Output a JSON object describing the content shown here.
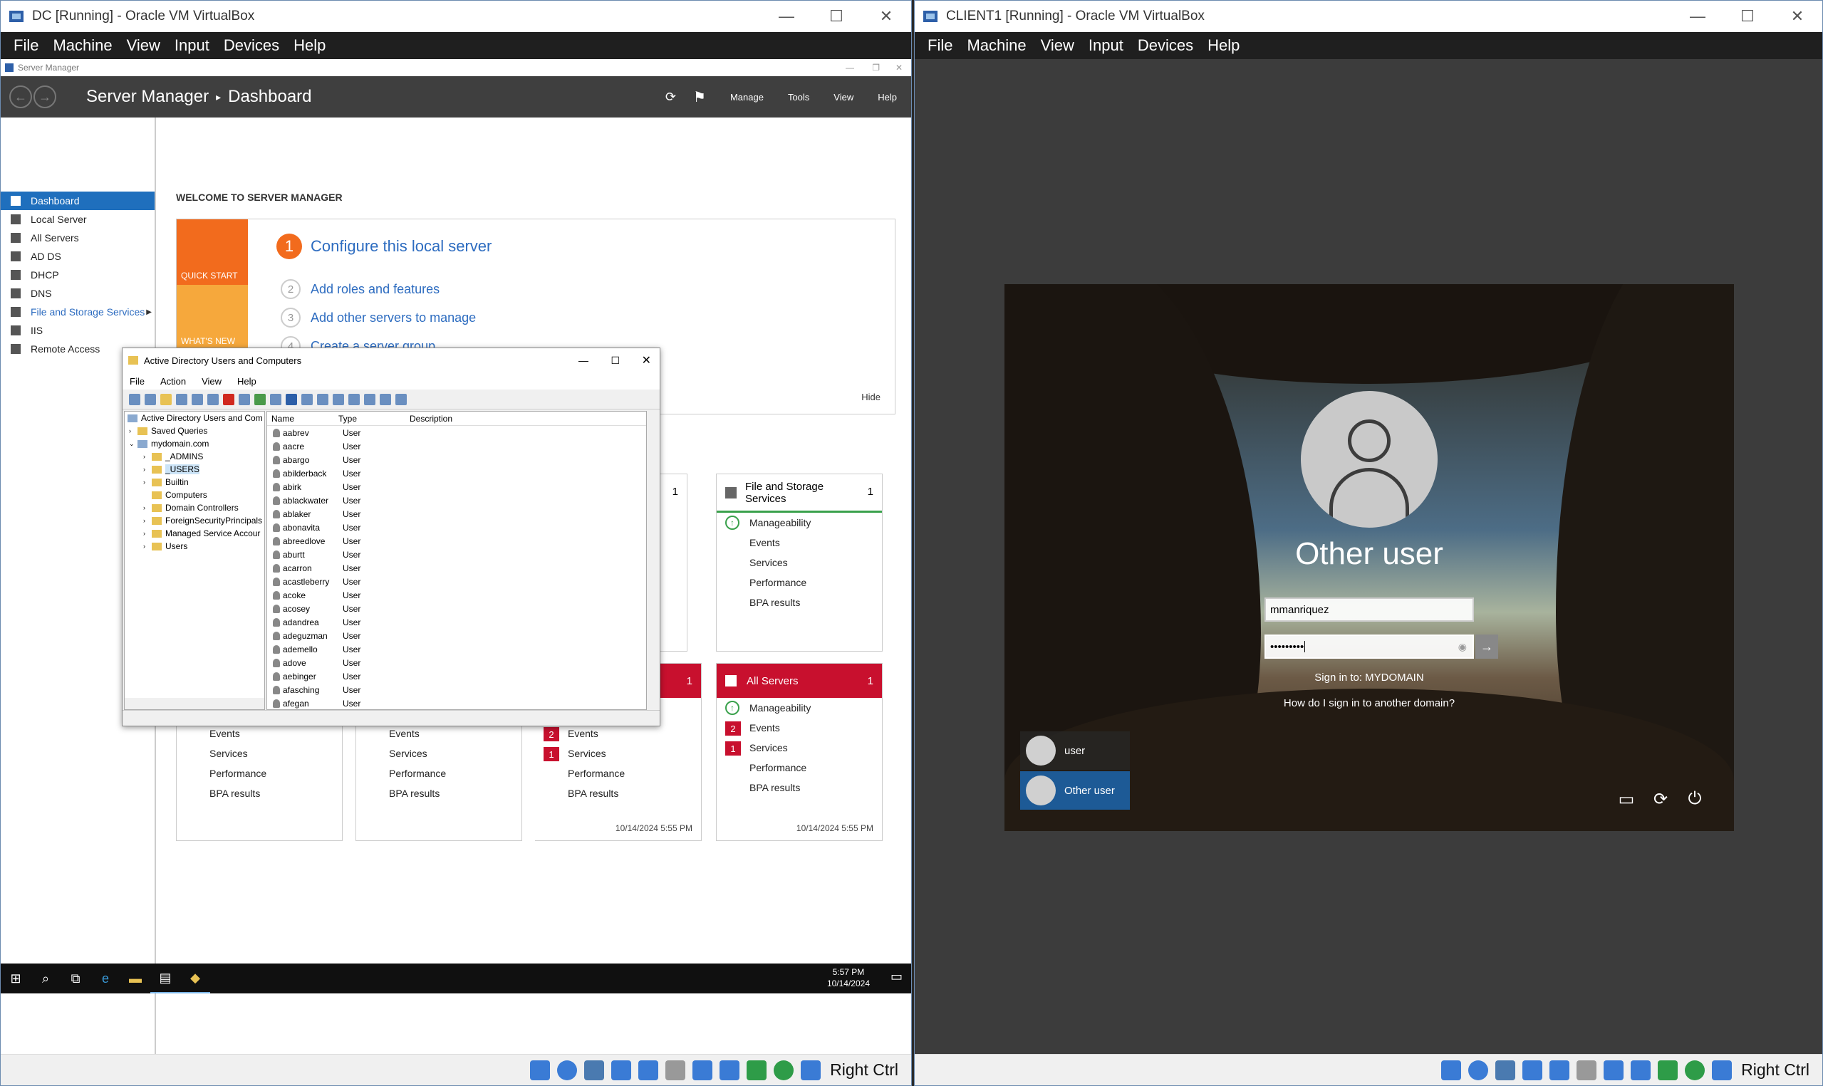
{
  "left_vm": {
    "title": "DC [Running] - Oracle VM VirtualBox",
    "menu": [
      "File",
      "Machine",
      "View",
      "Input",
      "Devices",
      "Help"
    ],
    "host_key": "Right Ctrl"
  },
  "server_manager": {
    "window_title": "Server Manager",
    "breadcrumb_app": "Server Manager",
    "breadcrumb_page": "Dashboard",
    "header_links": [
      "Manage",
      "Tools",
      "View",
      "Help"
    ],
    "sidebar": [
      {
        "label": "Dashboard",
        "selected": true
      },
      {
        "label": "Local Server"
      },
      {
        "label": "All Servers"
      },
      {
        "label": "AD DS"
      },
      {
        "label": "DHCP"
      },
      {
        "label": "DNS"
      },
      {
        "label": "File and Storage Services"
      },
      {
        "label": "IIS"
      },
      {
        "label": "Remote Access"
      }
    ],
    "welcome": "WELCOME TO SERVER MANAGER",
    "quick_start": "QUICK START",
    "whats_new": "WHAT'S NEW",
    "steps": [
      {
        "num": "1",
        "label": "Configure this local server"
      },
      {
        "num": "2",
        "label": "Add roles and features"
      },
      {
        "num": "3",
        "label": "Add other servers to manage"
      },
      {
        "num": "4",
        "label": "Create a server group"
      }
    ],
    "hide": "Hide",
    "tiles": {
      "file_storage": {
        "title": "File and Storage Services",
        "count": "1",
        "rows": [
          "Manageability",
          "Events",
          "Services",
          "Performance",
          "BPA results"
        ]
      },
      "all_servers": {
        "title": "All Servers",
        "count": "1",
        "rows": [
          "Manageability",
          "Events",
          "Services",
          "Performance",
          "BPA results"
        ],
        "events_badge": "2",
        "services_badge": "1",
        "timestamp": "10/14/2024 5:55 PM"
      },
      "tile3": {
        "count": "1",
        "rows": [
          "Events",
          "Services",
          "Performance",
          "BPA results"
        ],
        "events_badge": "2",
        "services_badge": "1",
        "timestamp": "10/14/2024 5:55 PM"
      },
      "tile3_top_count": "1",
      "tile1_rows": [
        "Events",
        "Services",
        "Performance",
        "BPA results"
      ],
      "tile2_rows": [
        "Events",
        "Services",
        "Performance",
        "BPA results"
      ]
    },
    "accent_red": "#c8102e",
    "accent_blue": "#1f6fbd"
  },
  "aduc": {
    "title": "Active Directory Users and Computers",
    "menu": [
      "File",
      "Action",
      "View",
      "Help"
    ],
    "tree": [
      {
        "label": "Active Directory Users and Com",
        "depth": 0
      },
      {
        "label": "Saved Queries",
        "depth": 1
      },
      {
        "label": "mydomain.com",
        "depth": 1
      },
      {
        "label": "_ADMINS",
        "depth": 2
      },
      {
        "label": "_USERS",
        "depth": 2,
        "selected": true
      },
      {
        "label": "Builtin",
        "depth": 2
      },
      {
        "label": "Computers",
        "depth": 2
      },
      {
        "label": "Domain Controllers",
        "depth": 2
      },
      {
        "label": "ForeignSecurityPrincipals",
        "depth": 2
      },
      {
        "label": "Managed Service Accour",
        "depth": 2
      },
      {
        "label": "Users",
        "depth": 2
      }
    ],
    "columns": [
      "Name",
      "Type",
      "Description"
    ],
    "users": [
      "aabrev",
      "aacre",
      "abargo",
      "abilderback",
      "abirk",
      "ablackwater",
      "ablaker",
      "abonavita",
      "abreedlove",
      "aburtt",
      "acarron",
      "acastleberry",
      "acoke",
      "acosey",
      "adandrea",
      "adeguzman",
      "ademello",
      "adove",
      "aebinger",
      "afasching",
      "afegan"
    ],
    "type_value": "User"
  },
  "taskbar": {
    "time": "5:57 PM",
    "date": "10/14/2024"
  },
  "right_vm": {
    "title": "CLIENT1 [Running] - Oracle VM VirtualBox",
    "menu": [
      "File",
      "Machine",
      "View",
      "Input",
      "Devices",
      "Help"
    ],
    "host_key": "Right Ctrl"
  },
  "lock_screen": {
    "user_heading": "Other user",
    "username_value": "mmanriquez",
    "password_mask": "•••••••••",
    "sign_in_to": "Sign in to: MYDOMAIN",
    "another_domain": "How do I sign in to another domain?",
    "users": [
      {
        "label": "user"
      },
      {
        "label": "Other user",
        "selected": true
      }
    ]
  }
}
